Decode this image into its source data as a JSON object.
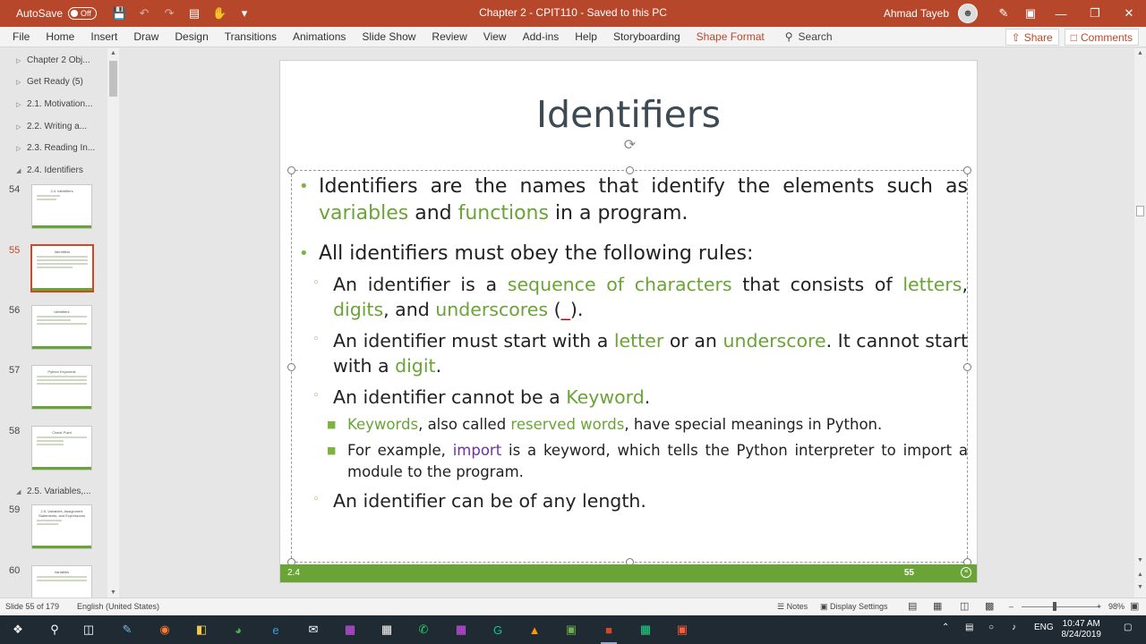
{
  "titlebar": {
    "autosave_label": "AutoSave",
    "autosave_state": "Off",
    "document_title": "Chapter 2 - CPIT110  -  Saved to this PC",
    "user_name": "Ahmad Tayeb",
    "accent_color": "#b7472a"
  },
  "ribbon": {
    "tabs": [
      "File",
      "Home",
      "Insert",
      "Draw",
      "Design",
      "Transitions",
      "Animations",
      "Slide Show",
      "Review",
      "View",
      "Add-ins",
      "Help",
      "Storyboarding",
      "Shape Format"
    ],
    "search_label": "Search",
    "share_label": "Share",
    "comments_label": "Comments"
  },
  "sidebar": {
    "sections": [
      "Chapter 2 Obj...",
      "Get Ready (5)",
      "2.1. Motivation...",
      "2.2. Writing a...",
      "2.3. Reading In...",
      "2.4. Identifiers",
      "2.5. Variables,..."
    ],
    "slides": [
      {
        "number": "54",
        "title": "2.4. Identifiers"
      },
      {
        "number": "55",
        "title": "Identifiers"
      },
      {
        "number": "56",
        "title": "Identifiers"
      },
      {
        "number": "57",
        "title": "Python Keywords"
      },
      {
        "number": "58",
        "title": "Check Point"
      },
      {
        "number": "59",
        "title": "2.5. Variables, Assignment Statements, and Expressions"
      },
      {
        "number": "60",
        "title": "Variables"
      }
    ]
  },
  "slide": {
    "title": "Identifiers",
    "b1": {
      "t1": "Identifiers are the names that identify the elements such as ",
      "g1": "variables",
      "t2": " and ",
      "g2": "functions",
      "t3": " in a program."
    },
    "b2": {
      "text": "All identifiers must obey the following rules:"
    },
    "s1": {
      "t1": "An identifier is a ",
      "g1": "sequence of characters",
      "t2": " that consists of ",
      "g2": "letters",
      "t3": ", ",
      "g3": "digits",
      "t4": ", and ",
      "g4": "underscores",
      "t5": " (",
      "r1": "_",
      "t6": ")."
    },
    "s2": {
      "t1": "An identifier must start with a ",
      "g1": "letter",
      "t2": " or an ",
      "g2": "underscore",
      "t3": ". It cannot start with a ",
      "g3": "digit",
      "t4": "."
    },
    "s3": {
      "t1": "An identifier cannot be a ",
      "g1": "Keyword",
      "t2": "."
    },
    "ss1": {
      "g1": "Keywords",
      "t1": ", also called ",
      "g2": "reserved words",
      "t2": ", have special meanings in Python."
    },
    "ss2": {
      "t1": "For example, ",
      "p1": "import",
      "t2": " is a keyword, which tells the Python interpreter to import a module to the program."
    },
    "s4": {
      "text": "An identifier can be of any length."
    },
    "footer_left": "2.4",
    "footer_number": "55",
    "accent_color": "#6aa436",
    "keyword_color": "#7030a0"
  },
  "status": {
    "slide_info": "Slide 55 of 179",
    "language": "English (United States)",
    "notes_label": "Notes",
    "display_settings_label": "Display Settings",
    "zoom": "98%"
  },
  "taskbar": {
    "time": "10:47 AM",
    "date": "8/24/2019",
    "input_lang": "ENG"
  }
}
